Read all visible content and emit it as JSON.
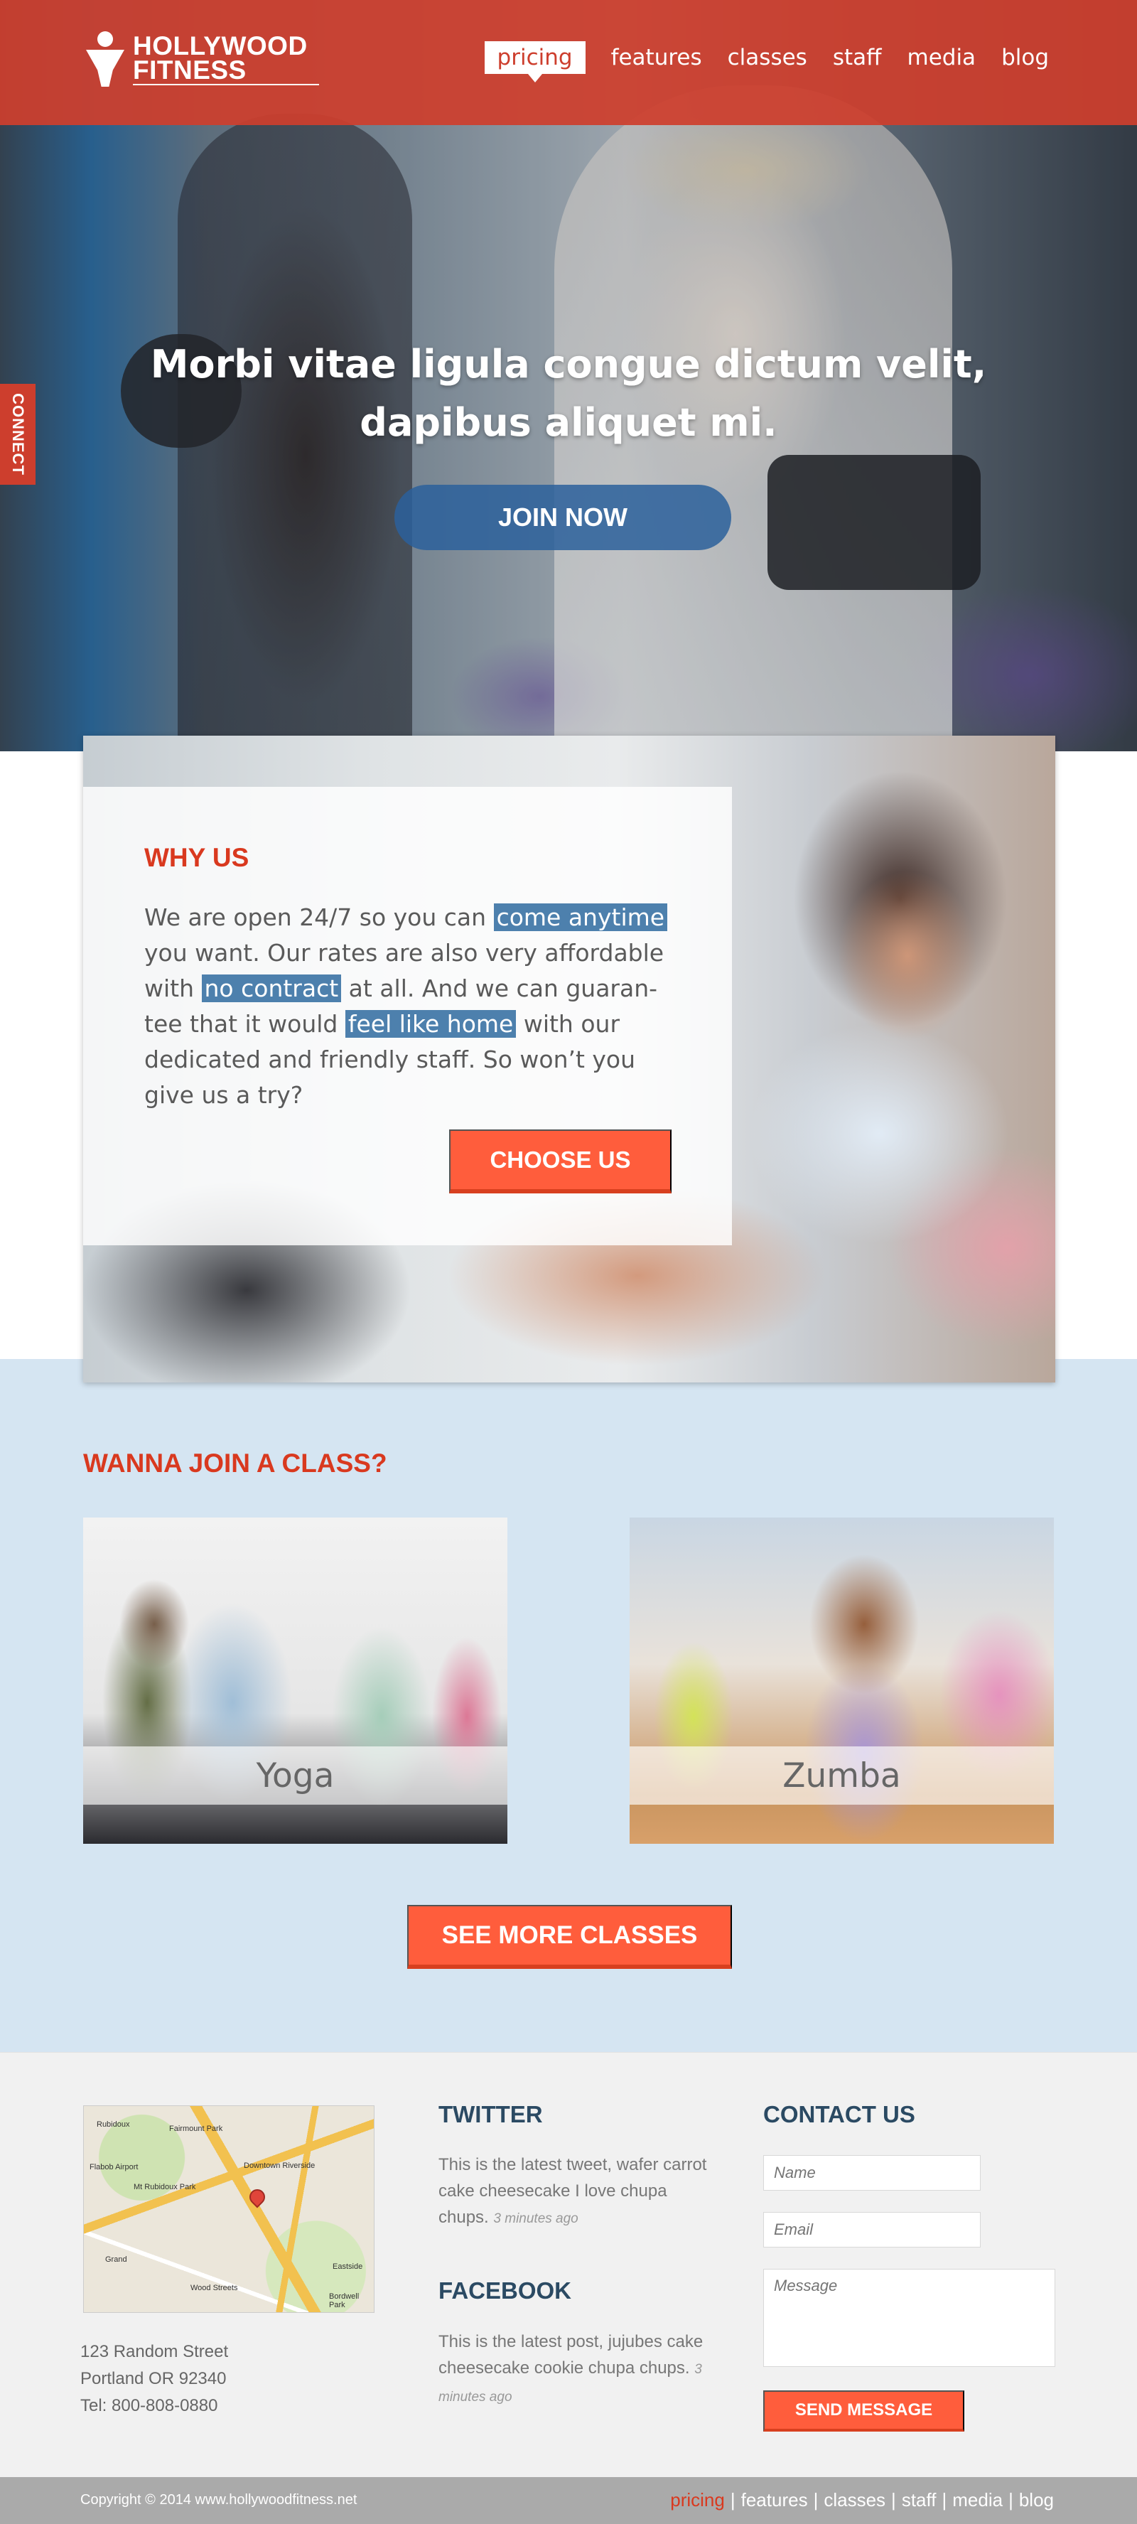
{
  "brand": {
    "line1": "HOLLYWOOD",
    "line2": "FITNESS"
  },
  "nav": {
    "items": [
      "pricing",
      "features",
      "classes",
      "staff",
      "media",
      "blog"
    ],
    "active": "pricing"
  },
  "side_tab": {
    "label": "CONNECT"
  },
  "hero": {
    "headline": "Morbi vitae ligula congue dictum velit, dapibus aliquet mi.",
    "cta": "JOIN NOW"
  },
  "why": {
    "title": "WHY US",
    "text_1": "We are open 24/7 so you can ",
    "hl_1": "come anytime",
    "text_2": " you want. Our rates are also very affordable with ",
    "hl_2": "no contract",
    "text_3": " at all. And we can guaran-tee that it would ",
    "hl_3": "feel like home",
    "text_4": " with our dedicated and friendly staff. So won’t you give us a try?",
    "cta": "CHOOSE US"
  },
  "classes": {
    "title": "WANNA JOIN A CLASS?",
    "items": [
      {
        "label": "Yoga"
      },
      {
        "label": "Zumba"
      }
    ],
    "cta": "SEE MORE CLASSES"
  },
  "footer": {
    "map_labels": [
      "Rubidoux",
      "Fairmount Park",
      "Flabob Airport",
      "Mt Rubidoux Park",
      "Downtown Riverside",
      "Grand",
      "Wood Streets",
      "Eastside",
      "Bordwell Park"
    ],
    "address": [
      "123 Random Street",
      "Portland OR 92340",
      "Tel: 800-808-0880"
    ],
    "twitter": {
      "title": "TWITTER",
      "text": "This is the latest tweet, wafer carrot cake cheesecake I love chupa chups. ",
      "ago": "3 minutes ago"
    },
    "facebook": {
      "title": "FACEBOOK",
      "text": "This is the latest post, jujubes cake cheesecake cookie chupa chups. ",
      "ago": "3 minutes ago"
    },
    "contact": {
      "title": "CONTACT US",
      "name_placeholder": "Name",
      "email_placeholder": "Email",
      "message_placeholder": "Message",
      "send": "SEND MESSAGE"
    }
  },
  "bottom": {
    "copyright": "Copyright © 2014 www.hollywoodfitness.net",
    "nav": [
      "pricing",
      "features",
      "classes",
      "staff",
      "media",
      "blog"
    ]
  },
  "colors": {
    "brand_red": "#cd3e2d",
    "accent_orange": "#ff5d3c",
    "highlight_blue": "#4d80ad",
    "heading_navy": "#2b4a63",
    "classes_bg": "#d5e5f2"
  }
}
